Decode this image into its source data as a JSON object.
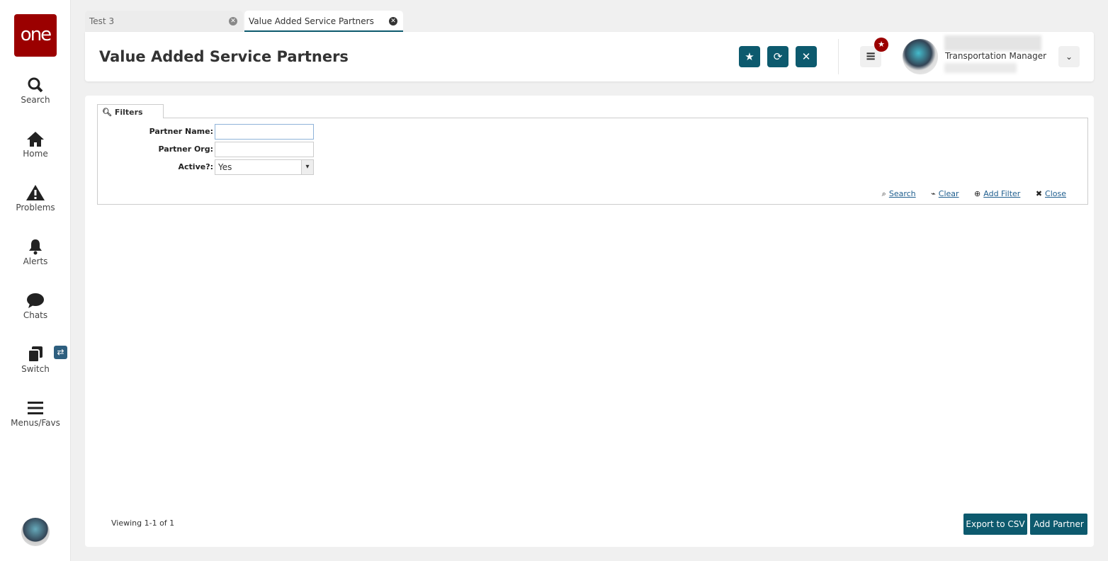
{
  "sidebar": {
    "logo": "one",
    "items": [
      {
        "label": "Search",
        "icon": "search-icon"
      },
      {
        "label": "Home",
        "icon": "home-icon"
      },
      {
        "label": "Problems",
        "icon": "warning-icon"
      },
      {
        "label": "Alerts",
        "icon": "bell-icon"
      },
      {
        "label": "Chats",
        "icon": "chat-icon"
      },
      {
        "label": "Switch",
        "icon": "switch-icon"
      },
      {
        "label": "Menus/Favs",
        "icon": "menu-icon"
      }
    ]
  },
  "tabs": [
    {
      "label": "Test 3",
      "active": false
    },
    {
      "label": "Value Added Service Partners",
      "active": true
    }
  ],
  "header": {
    "title": "Value Added Service Partners",
    "user_role": "Transportation Manager"
  },
  "filters": {
    "tab_label": "Filters",
    "fields": [
      {
        "label": "Partner Name:",
        "value": ""
      },
      {
        "label": "Partner Org:",
        "value": ""
      },
      {
        "label": "Active?:",
        "value": "Yes"
      }
    ],
    "actions": {
      "search": "Search",
      "clear": "Clear",
      "add_filter": "Add Filter",
      "close": "Close"
    }
  },
  "footer": {
    "viewing": "Viewing 1-1 of 1",
    "export": "Export to CSV",
    "add": "Add Partner"
  },
  "colors": {
    "accent": "#0d5a6e",
    "brand": "#9b0000"
  }
}
